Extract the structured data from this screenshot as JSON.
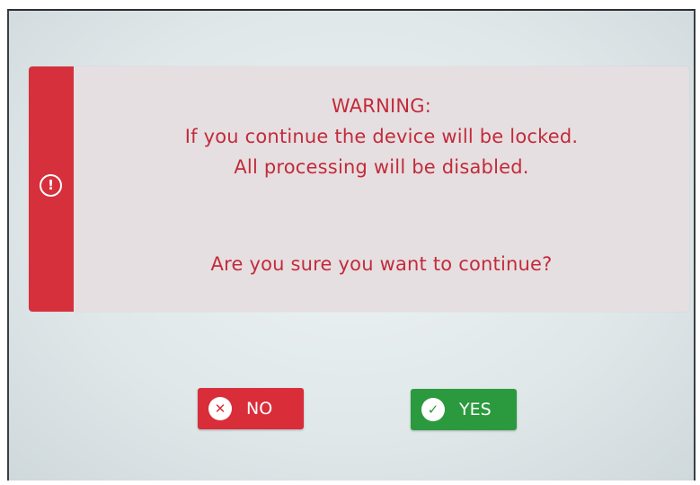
{
  "dialog": {
    "title": "WARNING:",
    "line1": "If you continue the device will be locked.",
    "line2": "All processing will be disabled.",
    "question": "Are you sure you want to continue?",
    "icon": "exclamation-circle-icon",
    "icon_glyph": "!"
  },
  "buttons": {
    "no": {
      "label": "NO",
      "icon": "close-circle-icon",
      "icon_glyph": "✕",
      "color": "#d92d3a"
    },
    "yes": {
      "label": "YES",
      "icon": "check-circle-icon",
      "icon_glyph": "✓",
      "color": "#2b9a3f"
    }
  },
  "colors": {
    "accent_red": "#d6303c",
    "text_red": "#c22b3a",
    "panel_bg": "#e6dfe1"
  }
}
